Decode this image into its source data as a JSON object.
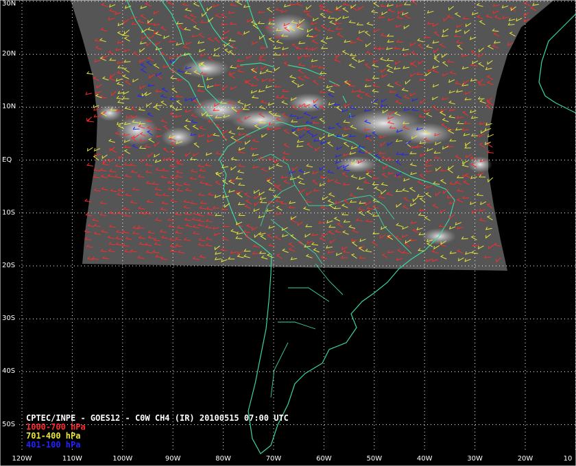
{
  "caption": {
    "title": "CPTEC/INPE - GOES12 - C0W CH4 (IR) 20100515 07:00 UTC",
    "legend": [
      {
        "label": "1000-700 hPa",
        "color": "#ff2a2a"
      },
      {
        "label": "701-400 hPa",
        "color": "#e8e838"
      },
      {
        "label": "401-100 hPa",
        "color": "#2222ff"
      }
    ]
  },
  "axes": {
    "lat_labels": [
      {
        "lat": 30,
        "text": "30N"
      },
      {
        "lat": 20,
        "text": "20N"
      },
      {
        "lat": 10,
        "text": "10N"
      },
      {
        "lat": 0,
        "text": "EQ"
      },
      {
        "lat": -10,
        "text": "10S"
      },
      {
        "lat": -20,
        "text": "20S"
      },
      {
        "lat": -30,
        "text": "30S"
      },
      {
        "lat": -40,
        "text": "40S"
      },
      {
        "lat": -50,
        "text": "50S"
      }
    ],
    "lon_labels": [
      {
        "lon": -120,
        "text": "120W"
      },
      {
        "lon": -110,
        "text": "110W"
      },
      {
        "lon": -100,
        "text": "100W"
      },
      {
        "lon": -90,
        "text": "90W"
      },
      {
        "lon": -80,
        "text": "80W"
      },
      {
        "lon": -70,
        "text": "70W"
      },
      {
        "lon": -60,
        "text": "60W"
      },
      {
        "lon": -50,
        "text": "50W"
      },
      {
        "lon": -40,
        "text": "40W"
      },
      {
        "lon": -30,
        "text": "30W"
      },
      {
        "lon": -20,
        "text": "20W"
      },
      {
        "lon": -10,
        "text": "10"
      }
    ]
  },
  "colors": {
    "coastline": "#3ad8a0",
    "grid": "#ffffff",
    "satellite_bg": "#5a5a5a",
    "background": "#000000"
  }
}
